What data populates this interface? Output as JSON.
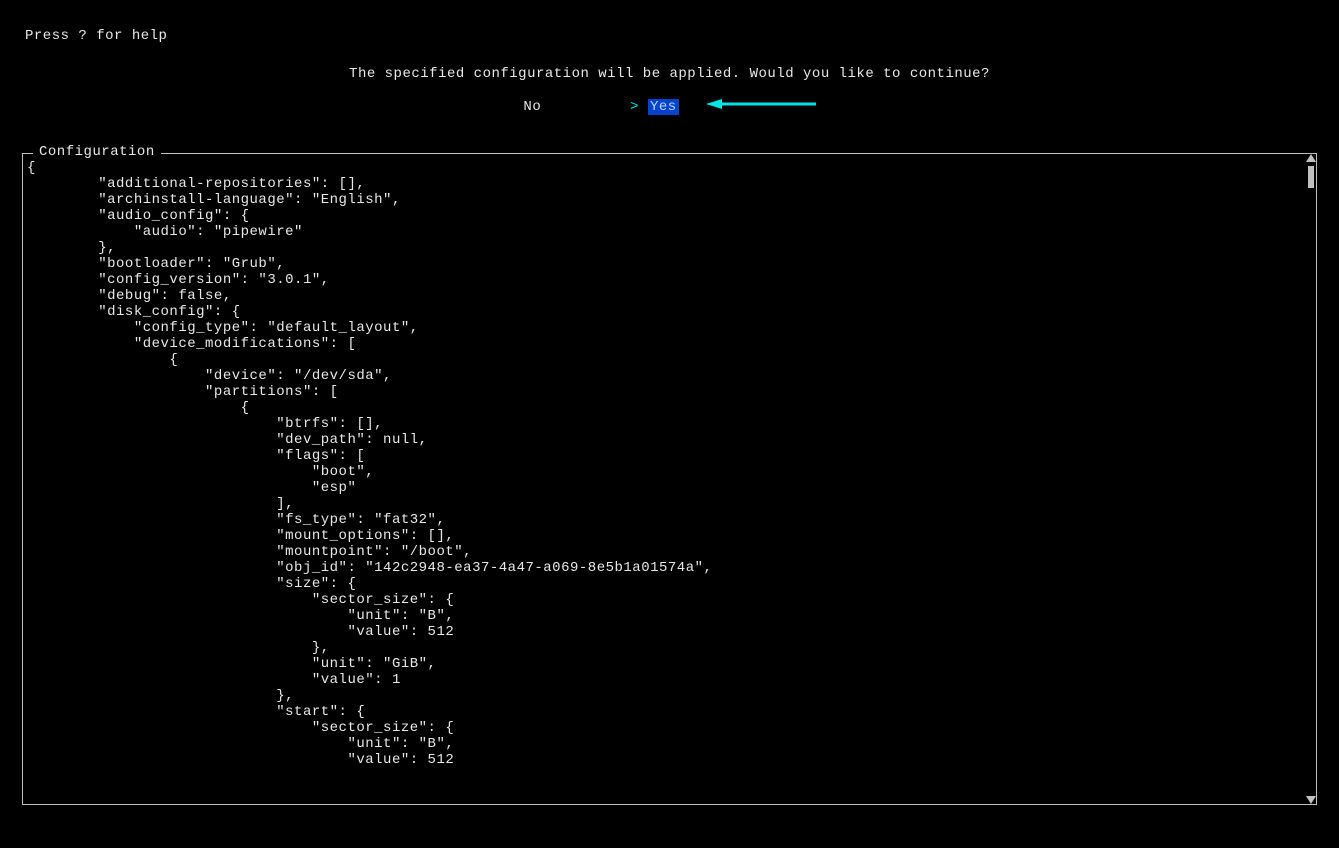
{
  "help_hint": "Press ? for help",
  "prompt": "The specified configuration will be applied. Would you like to continue?",
  "choices": {
    "no": "No",
    "cursor": "> ",
    "yes": "Yes"
  },
  "config_legend": "Configuration",
  "arrow_color": "#00e5e5",
  "config_json": {
    "additional-repositories": [],
    "archinstall-language": "English",
    "audio_config": {
      "audio": "pipewire"
    },
    "bootloader": "Grub",
    "config_version": "3.0.1",
    "debug": false,
    "disk_config": {
      "config_type": "default_layout",
      "device_modifications": [
        {
          "device": "/dev/sda",
          "partitions": [
            {
              "btrfs": [],
              "dev_path": null,
              "flags": [
                "boot",
                "esp"
              ],
              "fs_type": "fat32",
              "mount_options": [],
              "mountpoint": "/boot",
              "obj_id": "142c2948-ea37-4a47-a069-8e5b1a01574a",
              "size": {
                "sector_size": {
                  "unit": "B",
                  "value": 512
                },
                "unit": "GiB",
                "value": 1
              },
              "start": {
                "sector_size": {
                  "unit": "B",
                  "value": 512
                }
              }
            }
          ]
        }
      ]
    }
  },
  "config_text": "{\n        \"additional-repositories\": [],\n        \"archinstall-language\": \"English\",\n        \"audio_config\": {\n            \"audio\": \"pipewire\"\n        },\n        \"bootloader\": \"Grub\",\n        \"config_version\": \"3.0.1\",\n        \"debug\": false,\n        \"disk_config\": {\n            \"config_type\": \"default_layout\",\n            \"device_modifications\": [\n                {\n                    \"device\": \"/dev/sda\",\n                    \"partitions\": [\n                        {\n                            \"btrfs\": [],\n                            \"dev_path\": null,\n                            \"flags\": [\n                                \"boot\",\n                                \"esp\"\n                            ],\n                            \"fs_type\": \"fat32\",\n                            \"mount_options\": [],\n                            \"mountpoint\": \"/boot\",\n                            \"obj_id\": \"142c2948-ea37-4a47-a069-8e5b1a01574a\",\n                            \"size\": {\n                                \"sector_size\": {\n                                    \"unit\": \"B\",\n                                    \"value\": 512\n                                },\n                                \"unit\": \"GiB\",\n                                \"value\": 1\n                            },\n                            \"start\": {\n                                \"sector_size\": {\n                                    \"unit\": \"B\",\n                                    \"value\": 512"
}
